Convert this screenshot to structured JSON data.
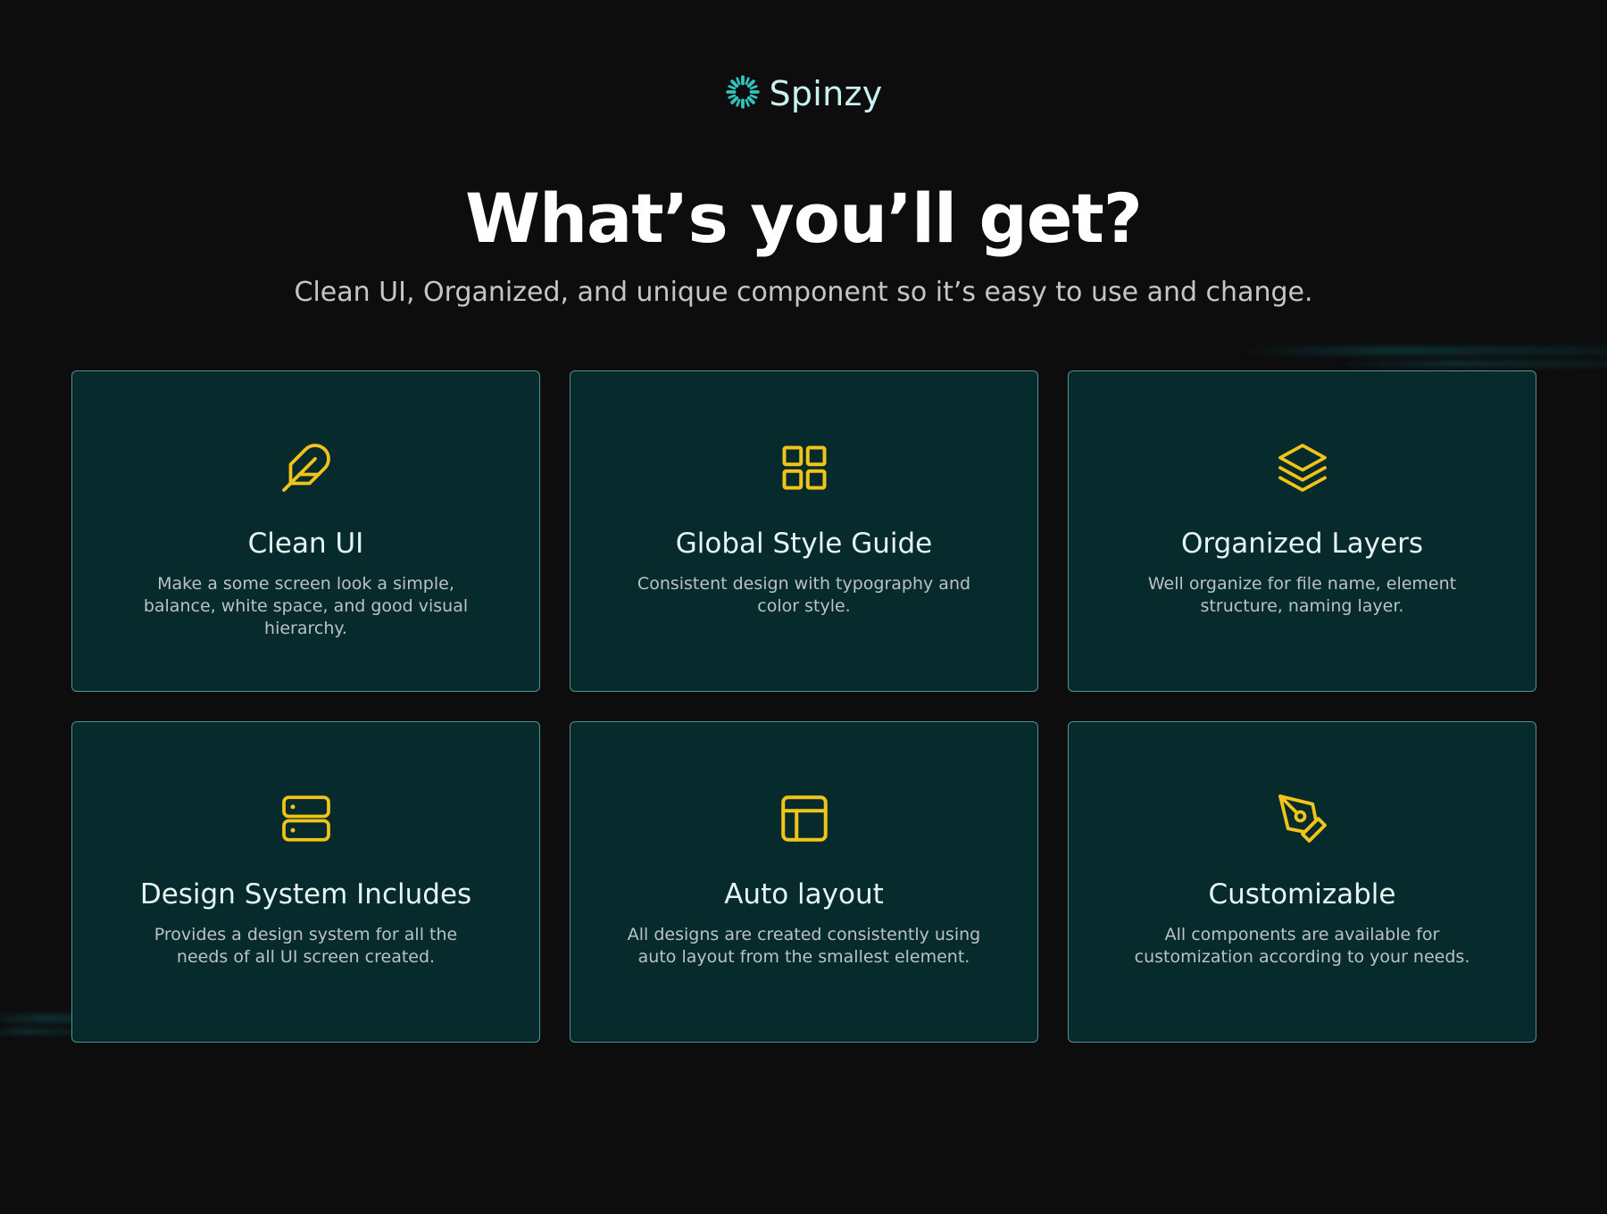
{
  "brand": {
    "name": "Spinzy",
    "logo_icon": "spinner-logo-icon",
    "logo_color": "#2fc4be"
  },
  "hero": {
    "title": "What’s you’ll get?",
    "subtitle": "Clean UI, Organized, and unique component so it’s easy to use and change."
  },
  "theme": {
    "background": "#0d0d0e",
    "card_background": "#072a2d",
    "card_border": "#4d9191",
    "icon_color": "#f0c419"
  },
  "features": [
    {
      "icon": "feather-icon",
      "title": "Clean UI",
      "description": "Make a some screen look a simple, balance, white space, and good visual hierarchy."
    },
    {
      "icon": "grid-icon",
      "title": "Global Style Guide",
      "description": "Consistent design with typography and color style."
    },
    {
      "icon": "layers-icon",
      "title": "Organized Layers",
      "description": "Well organize for file name, element structure, naming layer."
    },
    {
      "icon": "server-icon",
      "title": "Design System Includes",
      "description": "Provides a design system for all the needs of all UI screen created."
    },
    {
      "icon": "layout-icon",
      "title": "Auto layout",
      "description": "All designs are created consistently using auto layout from the smallest element."
    },
    {
      "icon": "pen-tool-icon",
      "title": "Customizable",
      "description": "All components are available for customization according to your needs."
    }
  ]
}
